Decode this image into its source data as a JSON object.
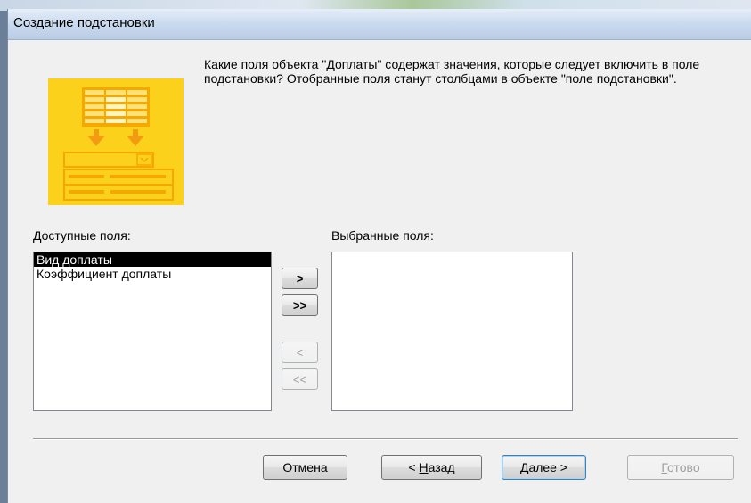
{
  "window": {
    "title": "Создание подстановки"
  },
  "instruction": "Какие поля объекта \"Доплаты\" содержат значения, которые следует включить в поле подстановки? Отобранные поля станут столбцами в объекте \"поле подстановки\".",
  "available": {
    "label": "Доступные поля:",
    "items": [
      "Вид доплаты",
      "Коэффициент доплаты"
    ],
    "selected_index": 0
  },
  "selected": {
    "label": "Выбранные поля:",
    "items": []
  },
  "move_buttons": {
    "add_one": ">",
    "add_all": ">>",
    "remove_one": "<",
    "remove_all": "<<"
  },
  "footer": {
    "cancel": "Отмена",
    "back_prefix": "< ",
    "back_hotkey": "Н",
    "back_rest": "азад",
    "next_hotkey": "Д",
    "next_rest": "алее >",
    "finish_hotkey": "Г",
    "finish_rest": "отово"
  },
  "colors": {
    "wizard_image": "#fbd11b",
    "dialog_background": "#f0f0f0",
    "selection": "#000000"
  },
  "icons": {
    "wizard_image": "lookup-wizard-illustration"
  }
}
